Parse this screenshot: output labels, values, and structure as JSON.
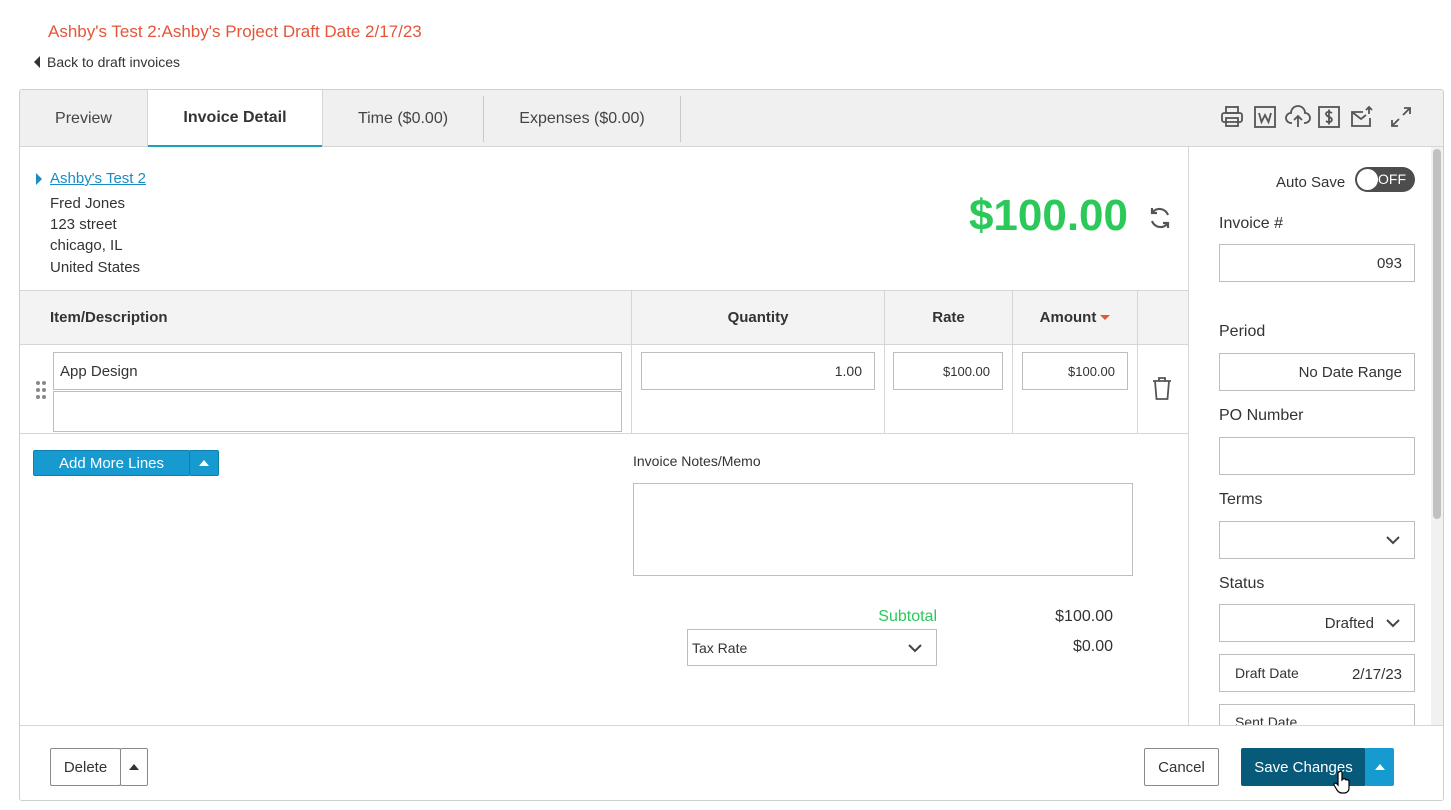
{
  "page_title": "Ashby's Test 2:Ashby's Project Draft Date 2/17/23",
  "back_link": "Back to draft invoices",
  "tabs": [
    {
      "label": "Preview"
    },
    {
      "label": "Invoice Detail"
    },
    {
      "label": "Time ($0.00)"
    },
    {
      "label": "Expenses ($0.00)"
    }
  ],
  "toolbar_icons": [
    "print-icon",
    "word-export-icon",
    "upload-icon",
    "payment-icon",
    "send-icon",
    "expand-icon"
  ],
  "client": {
    "name": "Ashby's Test 2",
    "contact": "Fred Jones",
    "street": "123 street",
    "city": "chicago, IL",
    "country": "United States"
  },
  "invoice_total": "$100.00",
  "table": {
    "headers": {
      "item": "Item/Description",
      "quantity": "Quantity",
      "rate": "Rate",
      "amount": "Amount"
    },
    "rows": [
      {
        "item": "App Design",
        "description": "",
        "quantity": "1.00",
        "rate": "$100.00",
        "amount": "$100.00"
      }
    ]
  },
  "add_lines_label": "Add More Lines",
  "notes": {
    "label": "Invoice Notes/Memo",
    "value": ""
  },
  "totals": {
    "subtotal_label": "Subtotal",
    "subtotal_value": "$100.00",
    "tax_rate_placeholder": "Tax Rate",
    "tax_value": "$0.00"
  },
  "sidebar": {
    "autosave_label": "Auto Save",
    "autosave_state": "OFF",
    "invoice_number_label": "Invoice #",
    "invoice_number": "093",
    "period_label": "Period",
    "period_value": "No Date Range",
    "po_label": "PO Number",
    "po_value": "",
    "terms_label": "Terms",
    "terms_value": "",
    "status_label": "Status",
    "status_value": "Drafted",
    "draft_date_label": "Draft Date",
    "draft_date": "2/17/23",
    "sent_date_label": "Sent Date"
  },
  "footer": {
    "delete_label": "Delete",
    "cancel_label": "Cancel",
    "save_label": "Save Changes"
  },
  "colors": {
    "title": "#e4553a",
    "total": "#2bc85a",
    "link": "#1a8cc4",
    "primary_button": "#169ad0",
    "save_button": "#075a7a",
    "tab_accent": "#1aa3b8"
  }
}
